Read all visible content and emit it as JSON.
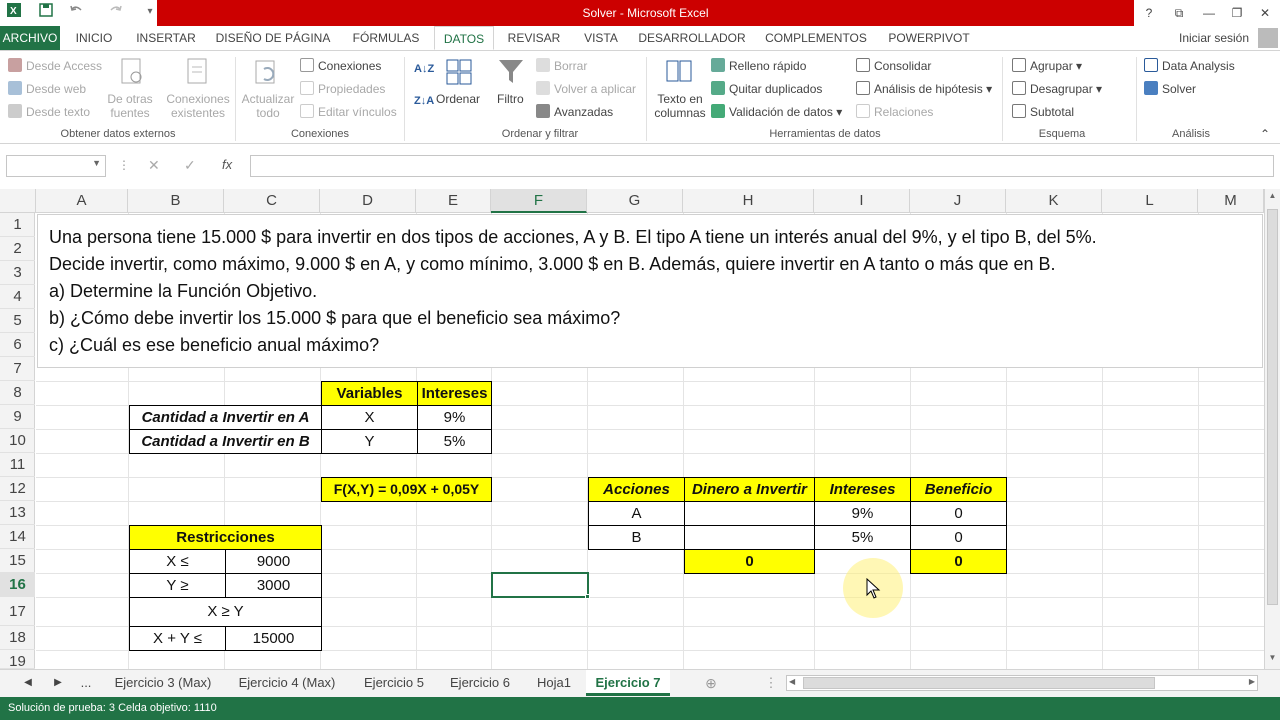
{
  "window": {
    "title": "Solver - Microsoft Excel",
    "buttons": [
      "?",
      "⧉",
      "—",
      "❐",
      "✕"
    ]
  },
  "qat_icons": [
    "excel-icon",
    "save-icon",
    "undo-icon",
    "redo-icon",
    "customize-icon"
  ],
  "tabs": [
    "ARCHIVO",
    "INICIO",
    "INSERTAR",
    "DISEÑO DE PÁGINA",
    "FÓRMULAS",
    "DATOS",
    "REVISAR",
    "VISTA",
    "DESARROLLADOR",
    "COMPLEMENTOS",
    "POWERPIVOT"
  ],
  "signin": "Iniciar sesión",
  "ribbon": {
    "ext": {
      "access": "Desde Access",
      "web": "Desde web",
      "text": "Desde texto",
      "other1": "De otras",
      "other2": "fuentes",
      "conn1": "Conexiones",
      "conn2": "existentes",
      "label": "Obtener datos externos"
    },
    "conexiones": {
      "refresh1": "Actualizar",
      "refresh2": "todo",
      "conexiones": "Conexiones",
      "propiedades": "Propiedades",
      "editar": "Editar vínculos",
      "label": "Conexiones"
    },
    "sort": {
      "ordenar": "Ordenar",
      "filtro": "Filtro",
      "borrar": "Borrar",
      "volver": "Volver a aplicar",
      "avanzadas": "Avanzadas",
      "label": "Ordenar y filtrar"
    },
    "tools": {
      "texto1": "Texto en",
      "texto2": "columnas",
      "relleno": "Relleno rápido",
      "quitar": "Quitar duplicados",
      "validacion": "Validación de datos",
      "consolidar": "Consolidar",
      "hipotesis": "Análisis de hipótesis",
      "relaciones": "Relaciones",
      "label": "Herramientas de datos"
    },
    "esquema": {
      "agrupar": "Agrupar",
      "desagrupar": "Desagrupar",
      "subtotal": "Subtotal",
      "label": "Esquema"
    },
    "analisis": {
      "data_analysis": "Data Analysis",
      "solver": "Solver",
      "label": "Análisis"
    }
  },
  "formula_bar": {
    "name_box": "",
    "fx": "fx",
    "formula": ""
  },
  "columns": [
    "A",
    "B",
    "C",
    "D",
    "E",
    "F",
    "G",
    "H",
    "I",
    "J",
    "K",
    "L",
    "M"
  ],
  "rows": [
    "1",
    "2",
    "3",
    "4",
    "5",
    "6",
    "7",
    "8",
    "9",
    "10",
    "11",
    "12",
    "13",
    "14",
    "15",
    "16",
    "17",
    "18",
    "19"
  ],
  "problem_lines": [
    "Una persona tiene 15.000 $ para invertir en dos tipos de acciones, A y B. El tipo A tiene un interés anual del 9%, y el tipo B, del 5%.",
    "Decide invertir, como máximo, 9.000 $ en A, y como mínimo, 3.000 $ en B. Además, quiere invertir en A tanto o más que en B.",
    "a) Determine la Función Objetivo.",
    "b) ¿Cómo debe invertir los 15.000 $ para que el beneficio sea máximo?",
    "c) ¿Cuál es ese beneficio anual máximo?"
  ],
  "variables_table": {
    "headers": [
      "Variables",
      "Intereses"
    ],
    "rows": [
      {
        "label": "Cantidad a Invertir en A",
        "var": "X",
        "interest": "9%"
      },
      {
        "label": "Cantidad a Invertir en B",
        "var": "Y",
        "interest": "5%"
      }
    ]
  },
  "objective": "F(X,Y) = 0,09X + 0,05Y",
  "restricciones": {
    "header": "Restricciones",
    "r1_label": "X ≤",
    "r1_value": "9000",
    "r2_label": "Y ≥",
    "r2_value": "3000",
    "r3": "X ≥ Y",
    "r4_label": "X + Y ≤",
    "r4_value": "15000"
  },
  "acciones_table": {
    "headers": [
      "Acciones",
      "Dinero a Invertir",
      "Intereses",
      "Beneficio"
    ],
    "rows": [
      {
        "accion": "A",
        "dinero": "",
        "interes": "9%",
        "beneficio": "0"
      },
      {
        "accion": "B",
        "dinero": "",
        "interes": "5%",
        "beneficio": "0"
      }
    ],
    "total_dinero": "0",
    "total_beneficio": "0"
  },
  "sheets": [
    "...",
    "Ejercicio 3 (Max)",
    "Ejercicio 4 (Max)",
    "Ejercicio 5",
    "Ejercicio 6",
    "Hoja1",
    "Ejercicio 7"
  ],
  "status": "Solución de prueba: 3  Celda objetivo: 1110"
}
